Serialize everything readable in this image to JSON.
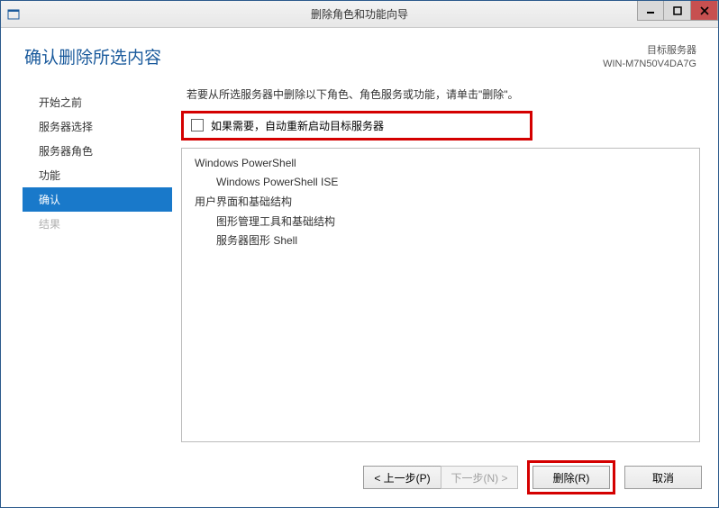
{
  "window": {
    "title": "删除角色和功能向导"
  },
  "header": {
    "page_title": "确认删除所选内容",
    "target_label": "目标服务器",
    "target_server": "WIN-M7N50V4DA7G"
  },
  "sidebar": {
    "items": [
      {
        "label": "开始之前"
      },
      {
        "label": "服务器选择"
      },
      {
        "label": "服务器角色"
      },
      {
        "label": "功能"
      },
      {
        "label": "确认",
        "selected": true
      },
      {
        "label": "结果",
        "disabled": true
      }
    ]
  },
  "main": {
    "instruction": "若要从所选服务器中删除以下角色、角色服务或功能，请单击\"删除\"。",
    "restart_checkbox_label": "如果需要，自动重新启动目标服务器",
    "restart_checked": false,
    "removal_items": [
      {
        "label": "Windows PowerShell",
        "level": 0
      },
      {
        "label": "Windows PowerShell ISE",
        "level": 1
      },
      {
        "label": "用户界面和基础结构",
        "level": 0
      },
      {
        "label": "图形管理工具和基础结构",
        "level": 1
      },
      {
        "label": "服务器图形 Shell",
        "level": 1
      }
    ]
  },
  "footer": {
    "previous": "< 上一步(P)",
    "next": "下一步(N) >",
    "remove": "删除(R)",
    "cancel": "取消"
  }
}
